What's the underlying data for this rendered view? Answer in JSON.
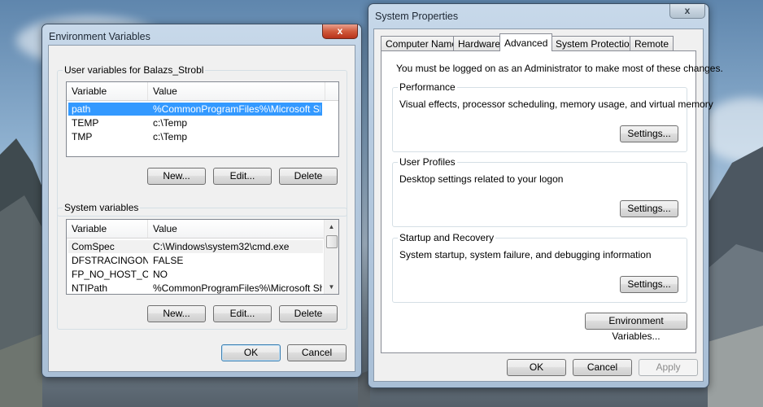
{
  "env_window": {
    "title": "Environment Variables",
    "close_label": "x",
    "user_group_label": "User variables for Balazs_Strobl",
    "user_columns": [
      "Variable",
      "Value"
    ],
    "user_rows": [
      {
        "variable": "path",
        "value": "%CommonProgramFiles%\\Microsoft Sh..."
      },
      {
        "variable": "TEMP",
        "value": "c:\\Temp"
      },
      {
        "variable": "TMP",
        "value": "c:\\Temp"
      }
    ],
    "user_buttons": {
      "new": "New...",
      "edit": "Edit...",
      "delete": "Delete"
    },
    "system_group_label": "System variables",
    "system_columns": [
      "Variable",
      "Value"
    ],
    "system_rows": [
      {
        "variable": "ComSpec",
        "value": "C:\\Windows\\system32\\cmd.exe"
      },
      {
        "variable": "DFSTRACINGON",
        "value": "FALSE"
      },
      {
        "variable": "FP_NO_HOST_C...",
        "value": "NO"
      },
      {
        "variable": "NTIPath",
        "value": "%CommonProgramFiles%\\Microsoft Sh..."
      }
    ],
    "system_buttons": {
      "new": "New...",
      "edit": "Edit...",
      "delete": "Delete"
    },
    "ok_label": "OK",
    "cancel_label": "Cancel"
  },
  "sys_window": {
    "title": "System Properties",
    "close_label": "x",
    "tabs": [
      {
        "label": "Computer Name"
      },
      {
        "label": "Hardware"
      },
      {
        "label": "Advanced",
        "active": true
      },
      {
        "label": "System Protection"
      },
      {
        "label": "Remote"
      }
    ],
    "admin_notice": "You must be logged on as an Administrator to make most of these changes.",
    "performance": {
      "label": "Performance",
      "description": "Visual effects, processor scheduling, memory usage, and virtual memory",
      "button": "Settings..."
    },
    "user_profiles": {
      "label": "User Profiles",
      "description": "Desktop settings related to your logon",
      "button": "Settings..."
    },
    "startup_recovery": {
      "label": "Startup and Recovery",
      "description": "System startup, system failure, and debugging information",
      "button": "Settings..."
    },
    "env_vars_button": "Environment Variables...",
    "ok_label": "OK",
    "cancel_label": "Cancel",
    "apply_label": "Apply"
  },
  "colors": {
    "selection": "#3399ff",
    "close_button": "#c7432a",
    "window_frame": "#b7cbe0"
  }
}
